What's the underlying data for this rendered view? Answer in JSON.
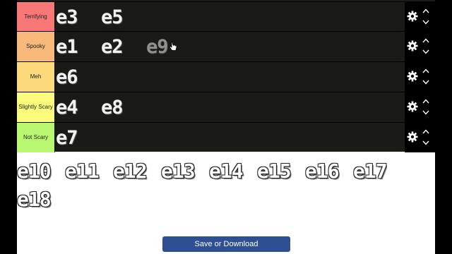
{
  "tiers": [
    {
      "label": "Terrifying",
      "color": "#f87777",
      "items": [
        "e3",
        "e5"
      ]
    },
    {
      "label": "Spooky",
      "color": "#f8b97a",
      "items": [
        "e1",
        "e2",
        "e9"
      ]
    },
    {
      "label": "Meh",
      "color": "#fcd97b",
      "items": [
        "e6"
      ]
    },
    {
      "label": "Slightly Scary",
      "color": "#fcfc7c",
      "items": [
        "e4",
        "e8"
      ]
    },
    {
      "label": "Not Scary",
      "color": "#b9f770",
      "items": [
        "e7"
      ]
    }
  ],
  "pool": {
    "row1": [
      "e10",
      "e11",
      "e12",
      "e13",
      "e14",
      "e15",
      "e16",
      "e17"
    ],
    "row2": [
      "e18"
    ]
  },
  "save_button": {
    "label": "Save or Download",
    "color": "#2e4f91"
  },
  "icons": {
    "settings": "gear-icon",
    "move_up": "chevron-up-icon",
    "move_down": "chevron-down-icon"
  }
}
